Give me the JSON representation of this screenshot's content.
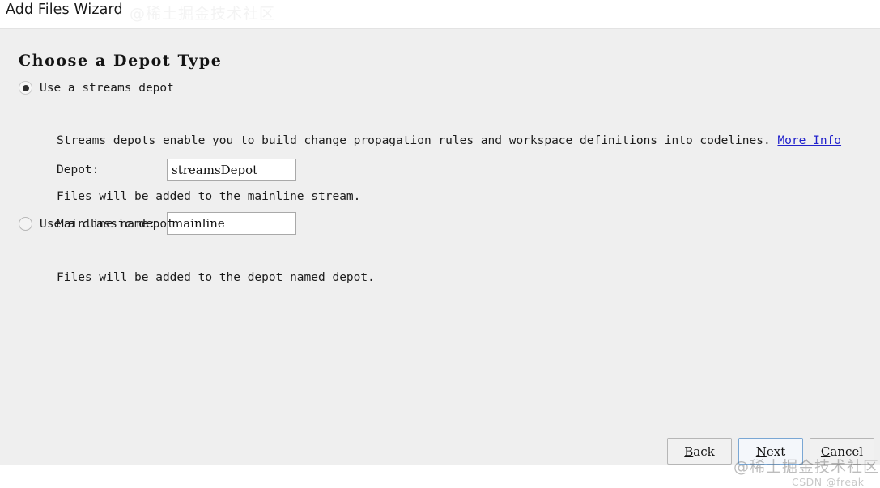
{
  "window": {
    "title": "Add Files Wizard"
  },
  "page": {
    "heading": "Choose a Depot Type"
  },
  "options": {
    "streams": {
      "label": "Use a streams depot",
      "selected": true,
      "description": "Streams depots enable you to build change propagation rules and workspace definitions into codelines.",
      "more_info_label": "More Info",
      "note": "Files will be added to the mainline stream.",
      "fields": [
        {
          "label": "Depot:",
          "value": "streamsDepot",
          "placeholder": "streamsDepot"
        },
        {
          "label": "Mainline name:",
          "value": "mainline",
          "placeholder": "mainline"
        }
      ]
    },
    "classic": {
      "label": "Use a classic depot",
      "selected": false,
      "note": "Files will be added to the depot named depot."
    }
  },
  "footer": {
    "buttons": [
      {
        "label": "Back",
        "mnemonic": "B",
        "rest": "ack",
        "focused": false
      },
      {
        "label": "Next",
        "mnemonic": "N",
        "rest": "ext",
        "focused": true
      },
      {
        "label": "Cancel",
        "mnemonic": "C",
        "rest": "ancel",
        "focused": false
      }
    ]
  },
  "watermarks": {
    "main": "@稀土掘金技术社区",
    "sub": "CSDN @freak",
    "top": "@稀土掘金技术社区"
  },
  "colors": {
    "panel_background": "#efefef",
    "header_background": "#ffffff",
    "link": "#2222cc",
    "focus_border": "#7aa7d4",
    "radio_dot": "#2e2e2e",
    "separator": "#8e8e8e"
  }
}
